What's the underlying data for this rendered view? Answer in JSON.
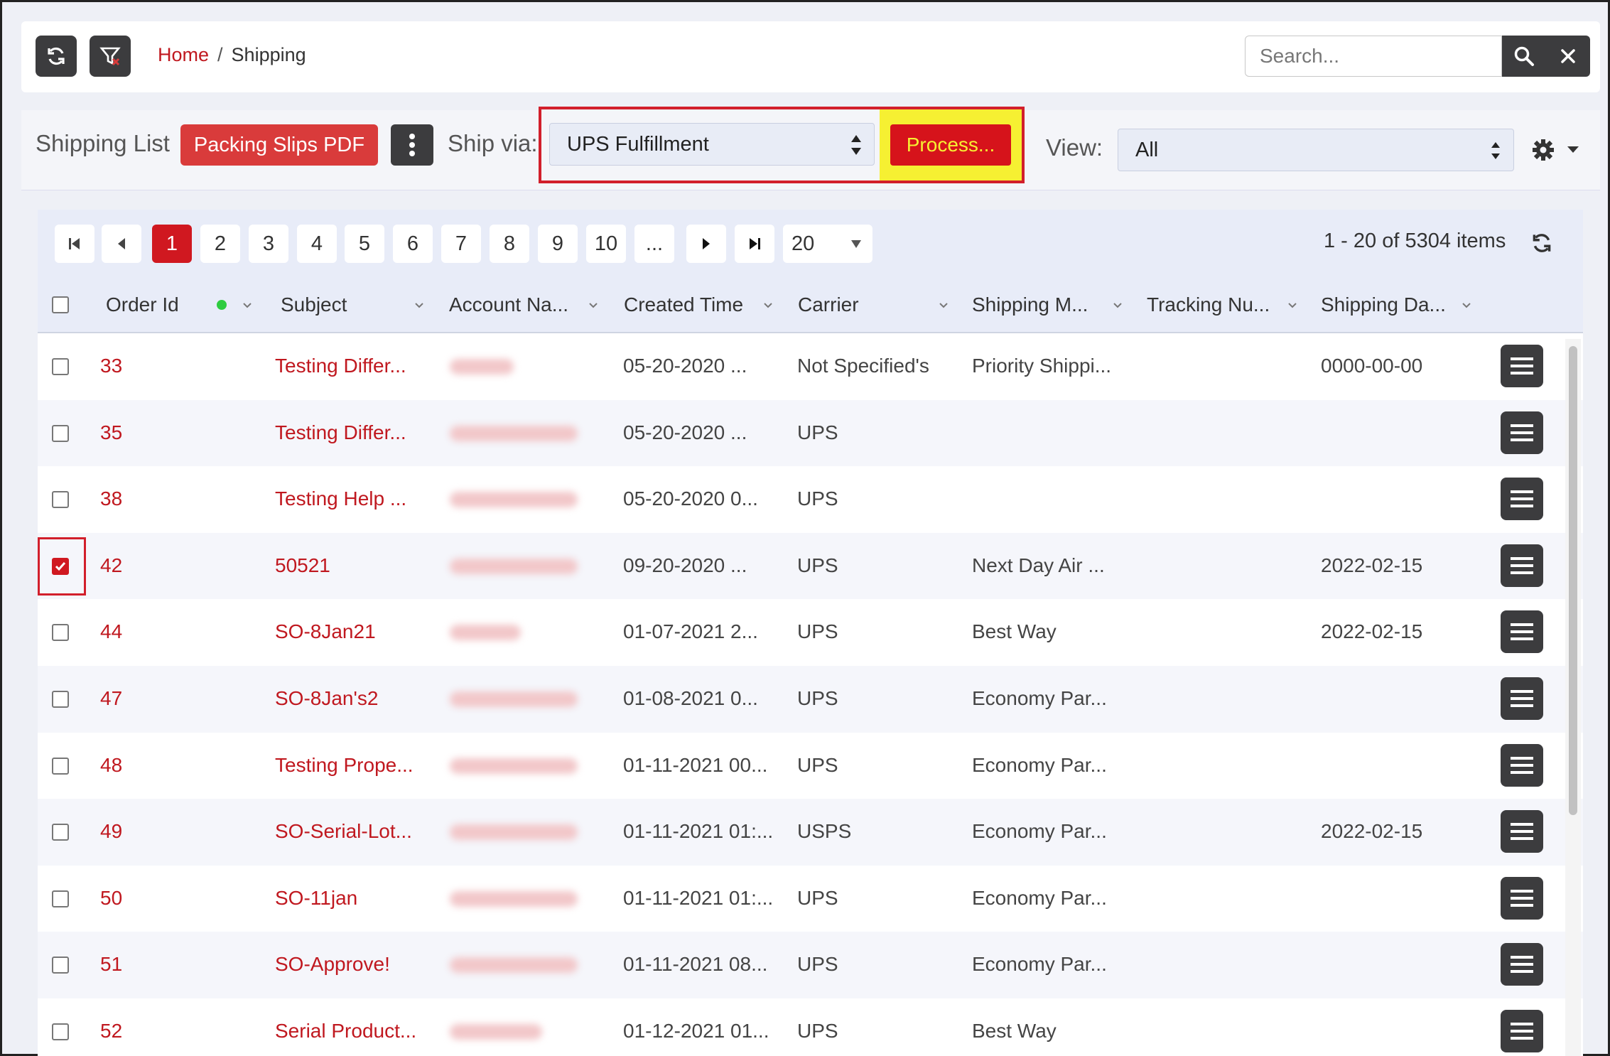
{
  "breadcrumb": {
    "home": "Home",
    "separator": "/",
    "current": "Shipping"
  },
  "search": {
    "placeholder": "Search..."
  },
  "toolbar": {
    "list_label": "Shipping List",
    "packing_slips": "Packing Slips PDF",
    "ship_via_label": "Ship via:",
    "ship_via_value": "UPS Fulfillment",
    "process_label": "Process...",
    "view_label": "View:",
    "view_value": "All"
  },
  "pager": {
    "pages": [
      "1",
      "2",
      "3",
      "4",
      "5",
      "6",
      "7",
      "8",
      "9",
      "10",
      "..."
    ],
    "current_page": "1",
    "page_size": "20",
    "info": "1 - 20 of 5304 items"
  },
  "columns": [
    "Order Id",
    "Subject",
    "Account Na...",
    "Created Time",
    "Carrier",
    "Shipping M...",
    "Tracking Nu...",
    "Shipping Da..."
  ],
  "rows": [
    {
      "order_id": "33",
      "subject": "Testing Differ...",
      "created": "05-20-2020 ...",
      "carrier": "Not Specified's",
      "shipping_method": "Priority Shippi...",
      "tracking": "",
      "ship_date": "0000-00-00",
      "checked": false
    },
    {
      "order_id": "35",
      "subject": "Testing Differ...",
      "created": "05-20-2020 ...",
      "carrier": "UPS",
      "shipping_method": "",
      "tracking": "",
      "ship_date": "",
      "checked": false
    },
    {
      "order_id": "38",
      "subject": "Testing Help ...",
      "created": "05-20-2020 0...",
      "carrier": "UPS",
      "shipping_method": "",
      "tracking": "",
      "ship_date": "",
      "checked": false
    },
    {
      "order_id": "42",
      "subject": "50521",
      "created": "09-20-2020 ...",
      "carrier": "UPS",
      "shipping_method": "Next Day Air ...",
      "tracking": "",
      "ship_date": "2022-02-15",
      "checked": true
    },
    {
      "order_id": "44",
      "subject": "SO-8Jan21",
      "created": "01-07-2021 2...",
      "carrier": "UPS",
      "shipping_method": "Best Way",
      "tracking": "",
      "ship_date": "2022-02-15",
      "checked": false
    },
    {
      "order_id": "47",
      "subject": "SO-8Jan's2",
      "created": "01-08-2021 0...",
      "carrier": "UPS",
      "shipping_method": "Economy Par...",
      "tracking": "",
      "ship_date": "",
      "checked": false
    },
    {
      "order_id": "48",
      "subject": "Testing Prope...",
      "created": "01-11-2021 00...",
      "carrier": "UPS",
      "shipping_method": "Economy Par...",
      "tracking": "",
      "ship_date": "",
      "checked": false
    },
    {
      "order_id": "49",
      "subject": "SO-Serial-Lot...",
      "created": "01-11-2021 01:...",
      "carrier": "USPS",
      "shipping_method": "Economy Par...",
      "tracking": "",
      "ship_date": "2022-02-15",
      "checked": false
    },
    {
      "order_id": "50",
      "subject": "SO-11jan",
      "created": "01-11-2021 01:...",
      "carrier": "UPS",
      "shipping_method": "Economy Par...",
      "tracking": "",
      "ship_date": "",
      "checked": false
    },
    {
      "order_id": "51",
      "subject": "SO-Approve!",
      "created": "01-11-2021 08...",
      "carrier": "UPS",
      "shipping_method": "Economy Par...",
      "tracking": "",
      "ship_date": "",
      "checked": false
    },
    {
      "order_id": "52",
      "subject": "Serial Product...",
      "created": "01-12-2021 01...",
      "carrier": "UPS",
      "shipping_method": "Best Way",
      "tracking": "",
      "ship_date": "",
      "checked": false
    }
  ],
  "icons": {
    "refresh": "refresh-icon",
    "filter": "filter-clear-icon",
    "search": "search-icon",
    "close": "close-icon",
    "kebab": "kebab-menu-icon",
    "gear": "gear-icon",
    "row_menu": "hamburger-icon"
  },
  "colors": {
    "accent": "#d01820",
    "highlight": "#f6f032",
    "dark_button": "#3c3c3e"
  }
}
